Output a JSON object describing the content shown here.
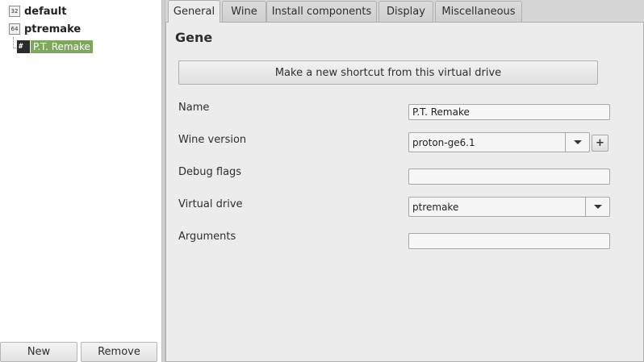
{
  "tree": {
    "items": [
      {
        "arch": "32",
        "label": "default"
      },
      {
        "arch": "64",
        "label": "ptremake"
      }
    ],
    "child": {
      "icon_text": "#",
      "label": "P.T. Remake",
      "selected_color": "#7fa65e"
    }
  },
  "left_buttons": {
    "new": "New",
    "remove": "Remove"
  },
  "tabs": [
    "General",
    "Wine",
    "Install components",
    "Display",
    "Miscellaneous"
  ],
  "active_tab": "General",
  "panel": {
    "heading": "General",
    "shortcut_button": "Make a new shortcut from this virtual drive",
    "fields": {
      "name": {
        "label": "Name",
        "value": "P.T. Remake"
      },
      "wine_version": {
        "label": "Wine version",
        "value": "proton-ge6.1",
        "add_icon": "plus-icon"
      },
      "debug_flags": {
        "label": "Debug flags",
        "value": ""
      },
      "virtual_drive": {
        "label": "Virtual drive",
        "value": "ptremake"
      },
      "arguments": {
        "label": "Arguments",
        "value": ""
      }
    }
  }
}
